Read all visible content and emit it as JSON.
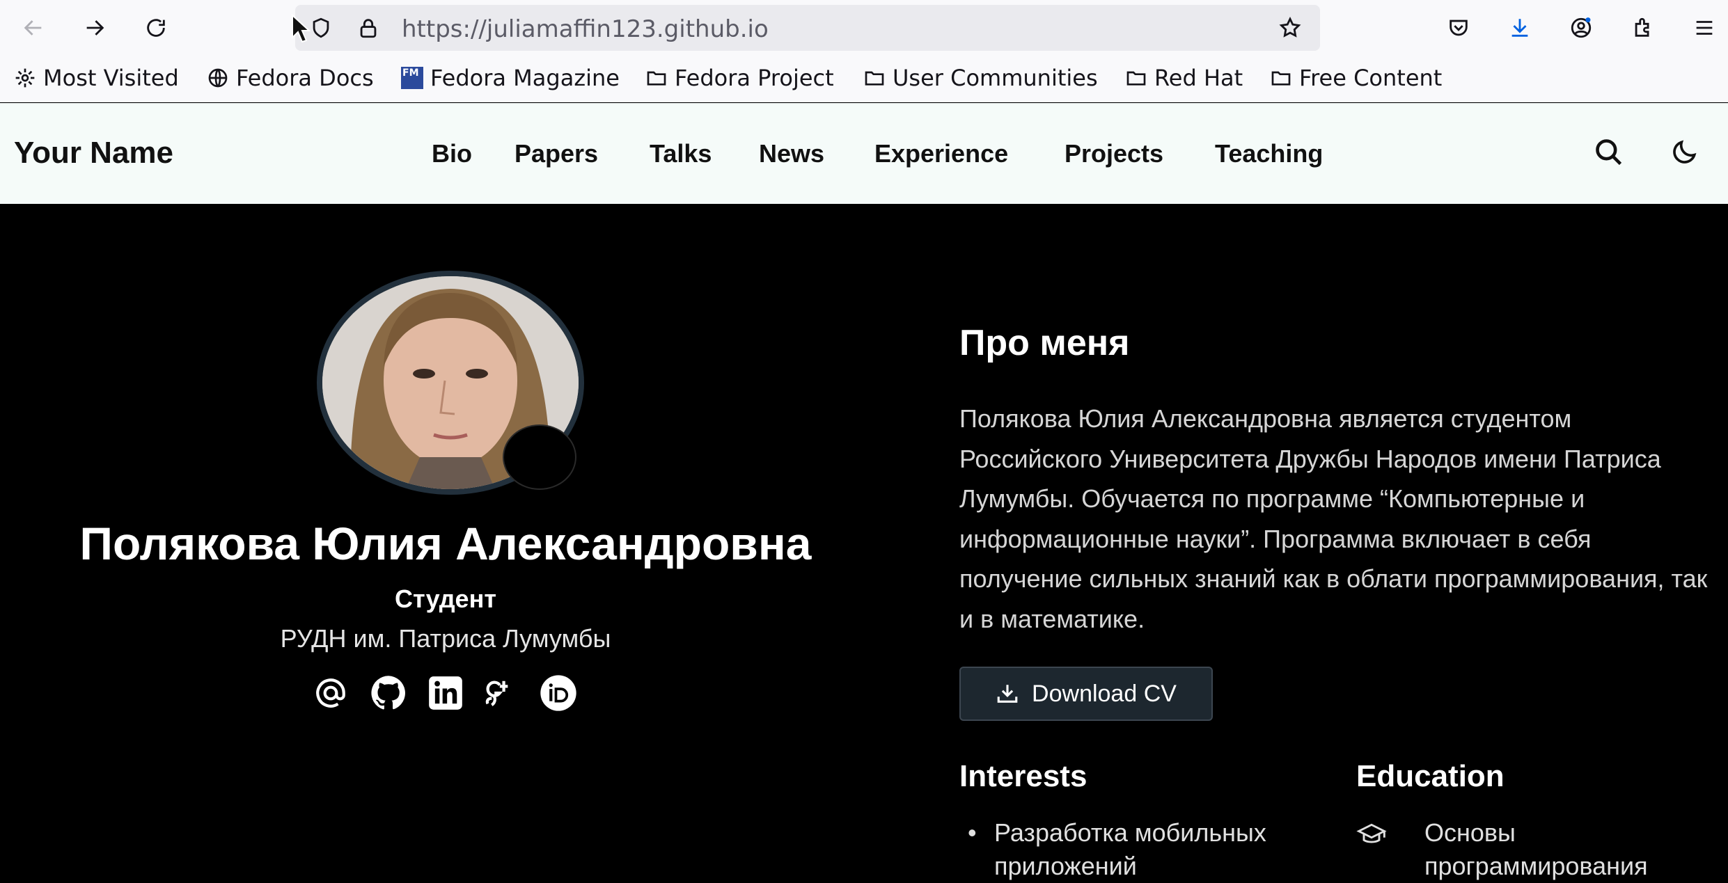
{
  "browser": {
    "url": "https://juliamaffin123.github.io",
    "bookmarks": [
      {
        "label": "Most Visited",
        "icon": "gear-icon"
      },
      {
        "label": "Fedora Docs",
        "icon": "globe-icon"
      },
      {
        "label": "Fedora Magazine",
        "icon": "fedora-magazine-icon",
        "badge": "FM"
      },
      {
        "label": "Fedora Project",
        "icon": "folder-icon"
      },
      {
        "label": "User Communities",
        "icon": "folder-icon"
      },
      {
        "label": "Red Hat",
        "icon": "folder-icon"
      },
      {
        "label": "Free Content",
        "icon": "folder-icon"
      }
    ]
  },
  "site": {
    "brand": "Your Name",
    "nav": [
      "Bio",
      "Papers",
      "Talks",
      "News",
      "Experience",
      "Projects",
      "Teaching"
    ]
  },
  "profile": {
    "name": "Полякова Юлия Александровна",
    "role": "Студент",
    "organization": "РУДН им. Патриса Лумумбы",
    "social_icons": [
      "email-icon",
      "github-icon",
      "linkedin-icon",
      "google-scholar-icon",
      "orcid-icon"
    ]
  },
  "about": {
    "heading": "Про меня",
    "paragraph": "Полякова Юлия Александровна является студентом Российского Университета Дружбы Народов имени Патриса Лумумбы. Обучается по программе “Компьютерные и информационные науки”. Программа включает в себя получение сильных знаний как в облати программирования, так и в математике.",
    "cv_button": "Download CV",
    "interests_heading": "Interests",
    "interests": [
      "Разработка мобильных приложений"
    ],
    "education_heading": "Education",
    "education": [
      "Основы программирования"
    ]
  },
  "colors": {
    "chrome_bg": "#f9f9fb",
    "nav_bg": "#f5fbf9",
    "hero_bg": "#000000",
    "button_bg": "#1d272f",
    "download_accent": "#0061e0"
  }
}
